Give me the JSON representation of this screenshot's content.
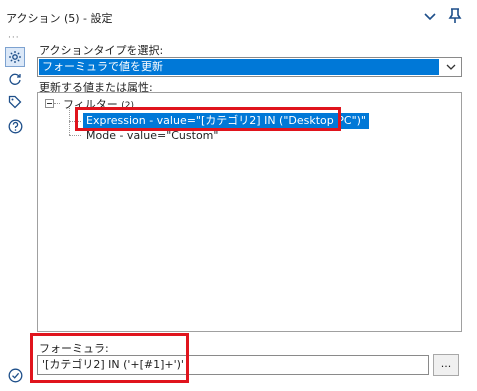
{
  "window": {
    "title": "アクション (5) - 設定"
  },
  "action_type": {
    "label": "アクションタイプを選択:",
    "selected": "フォーミュラで値を更新"
  },
  "tree": {
    "label": "更新する値または属性:",
    "root_label": "フィルター",
    "root_count": "(2)",
    "items": [
      {
        "label": "Expression - value=\"[カテゴリ2] IN (\"Desktop PC\")\"",
        "selected": true
      },
      {
        "label": "Mode - value=\"Custom\"",
        "selected": false
      }
    ]
  },
  "formula": {
    "label": "フォーミュラ:",
    "value": "'[カテゴリ2] IN ('+[#1]+')'",
    "browse_label": "..."
  },
  "colors": {
    "selection": "#0078d7",
    "highlight_box": "#e0141d",
    "icon_blue": "#1e4f8a"
  },
  "icons": [
    "chevron-down-icon",
    "pin-icon",
    "gear-icon",
    "refresh-icon",
    "tag-icon",
    "help-icon",
    "check-icon"
  ]
}
